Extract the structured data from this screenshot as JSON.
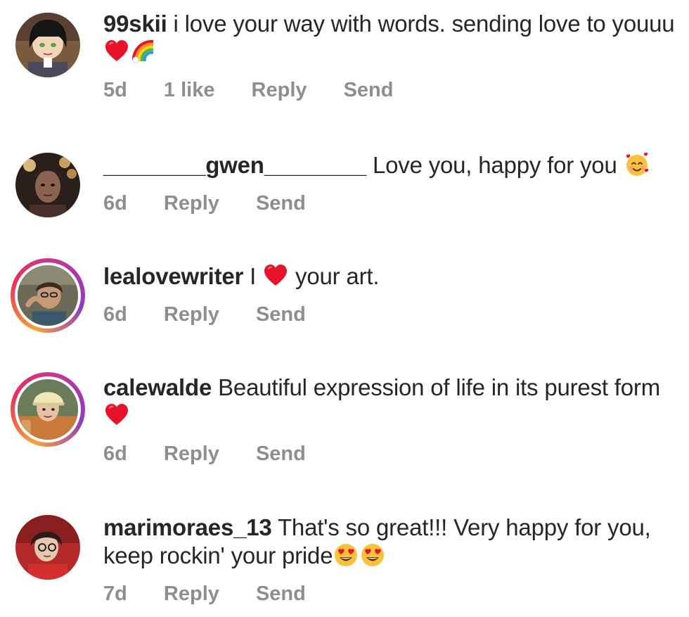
{
  "comments": [
    {
      "username": "99skii",
      "text_before": "i love your way with words. sending love to youuu",
      "text_after": "",
      "emojis_inline": [
        "red-heart-emoji",
        "rainbow-emoji"
      ],
      "time": "5d",
      "likes": "1 like",
      "reply_label": "Reply",
      "send_label": "Send",
      "has_story": false
    },
    {
      "username": "________gwen________",
      "text_before": "Love you, happy for you",
      "text_after": "",
      "emojis_inline": [
        "smiling-face-with-hearts-emoji"
      ],
      "time": "6d",
      "likes": "",
      "reply_label": "Reply",
      "send_label": "Send",
      "has_story": false
    },
    {
      "username": "lealovewriter",
      "text_before": "I",
      "text_after": "your art.",
      "emojis_inline": [
        "red-heart-emoji"
      ],
      "time": "6d",
      "likes": "",
      "reply_label": "Reply",
      "send_label": "Send",
      "has_story": true
    },
    {
      "username": "calewalde",
      "text_before": "Beautiful expression of life in its purest form",
      "text_after": "",
      "emojis_inline": [
        "red-heart-emoji"
      ],
      "time": "6d",
      "likes": "",
      "reply_label": "Reply",
      "send_label": "Send",
      "has_story": true
    },
    {
      "username": "marimoraes_13",
      "text_before": "That's so great!!! Very happy for you, keep rockin' your pride",
      "text_after": "",
      "emojis_inline": [
        "heart-eyes-emoji",
        "heart-eyes-emoji"
      ],
      "time": "7d",
      "likes": "",
      "reply_label": "Reply",
      "send_label": "Send",
      "has_story": false
    }
  ],
  "colors": {
    "text": "#262626",
    "meta": "#8e8e8e",
    "heart": "#e8132b",
    "story_ring_start": "#f7a33b",
    "story_ring_end": "#c1359b"
  }
}
